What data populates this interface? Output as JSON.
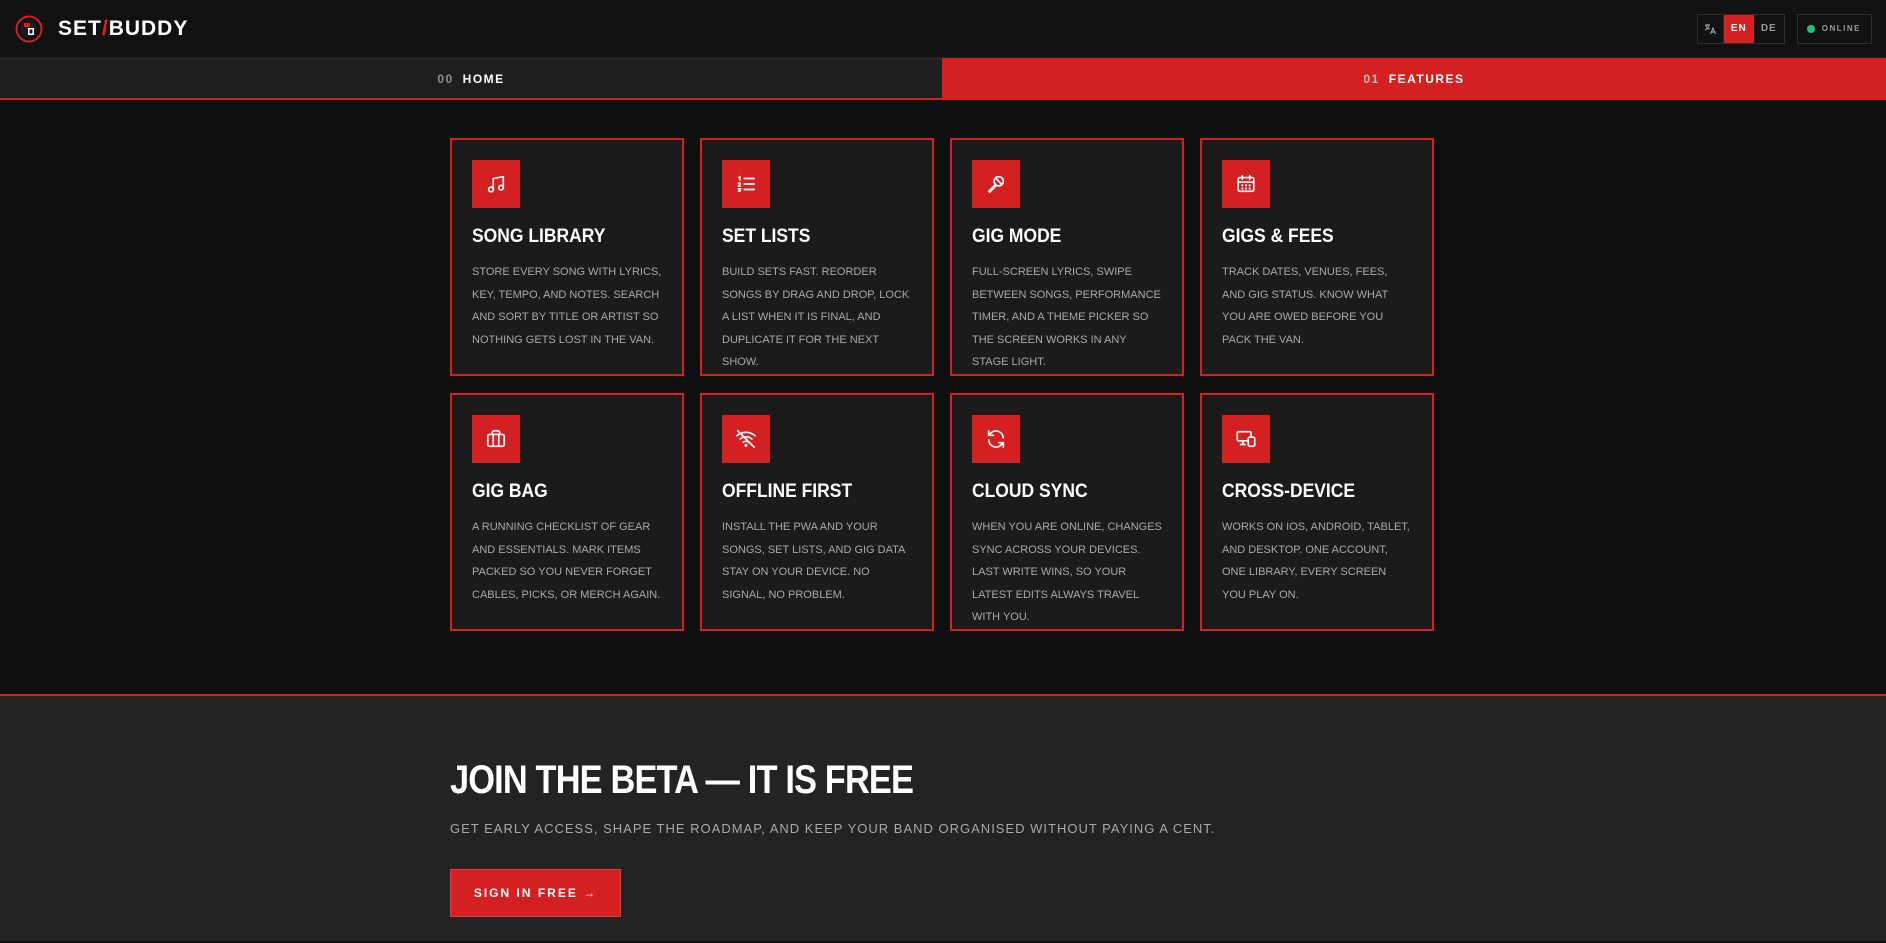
{
  "header": {
    "brand_left": "SET",
    "brand_slash": "/",
    "brand_right": "BUDDY",
    "languages": [
      "EN",
      "DE"
    ],
    "active_language": "EN",
    "status": "ONLINE",
    "status_color": "#19c37d"
  },
  "tabs": [
    {
      "num": "00",
      "label": "HOME",
      "active": false
    },
    {
      "num": "01",
      "label": "FEATURES",
      "active": true
    }
  ],
  "features": [
    {
      "icon": "music-note-icon",
      "title": "SONG LIBRARY",
      "text": "STORE EVERY SONG WITH LYRICS, KEY, TEMPO, AND NOTES. SEARCH AND SORT BY TITLE OR ARTIST SO NOTHING GETS LOST IN THE VAN."
    },
    {
      "icon": "numbered-list-icon",
      "title": "SET LISTS",
      "text": "BUILD SETS FAST. REORDER SONGS BY DRAG AND DROP, LOCK A LIST WHEN IT IS FINAL, AND DUPLICATE IT FOR THE NEXT SHOW."
    },
    {
      "icon": "microphone-icon",
      "title": "GIG MODE",
      "text": "FULL-SCREEN LYRICS, SWIPE BETWEEN SONGS, PERFORMANCE TIMER, AND A THEME PICKER SO THE SCREEN WORKS IN ANY STAGE LIGHT."
    },
    {
      "icon": "calendar-icon",
      "title": "GIGS & FEES",
      "text": "TRACK DATES, VENUES, FEES, AND GIG STATUS. KNOW WHAT YOU ARE OWED BEFORE YOU PACK THE VAN."
    },
    {
      "icon": "briefcase-icon",
      "title": "GIG BAG",
      "text": "A RUNNING CHECKLIST OF GEAR AND ESSENTIALS. MARK ITEMS PACKED SO YOU NEVER FORGET CABLES, PICKS, OR MERCH AGAIN."
    },
    {
      "icon": "wifi-off-icon",
      "title": "OFFLINE FIRST",
      "text": "INSTALL THE PWA AND YOUR SONGS, SET LISTS, AND GIG DATA STAY ON YOUR DEVICE. NO SIGNAL, NO PROBLEM."
    },
    {
      "icon": "sync-icon",
      "title": "CLOUD SYNC",
      "text": "WHEN YOU ARE ONLINE, CHANGES SYNC ACROSS YOUR DEVICES. LAST WRITE WINS, SO YOUR LATEST EDITS ALWAYS TRAVEL WITH YOU."
    },
    {
      "icon": "devices-icon",
      "title": "CROSS-DEVICE",
      "text": "WORKS ON IOS, ANDROID, TABLET, AND DESKTOP. ONE ACCOUNT, ONE LIBRARY, EVERY SCREEN YOU PLAY ON."
    }
  ],
  "cta": {
    "title": "JOIN THE BETA — IT IS FREE",
    "subtitle": "GET EARLY ACCESS, SHAPE THE ROADMAP, AND KEEP YOUR BAND ORGANISED WITHOUT PAYING A CENT.",
    "button": "SIGN IN FREE →"
  },
  "colors": {
    "accent": "#d42020",
    "background": "#0f0f0f",
    "card": "#1b1b1c",
    "cta_bg": "#232323"
  }
}
